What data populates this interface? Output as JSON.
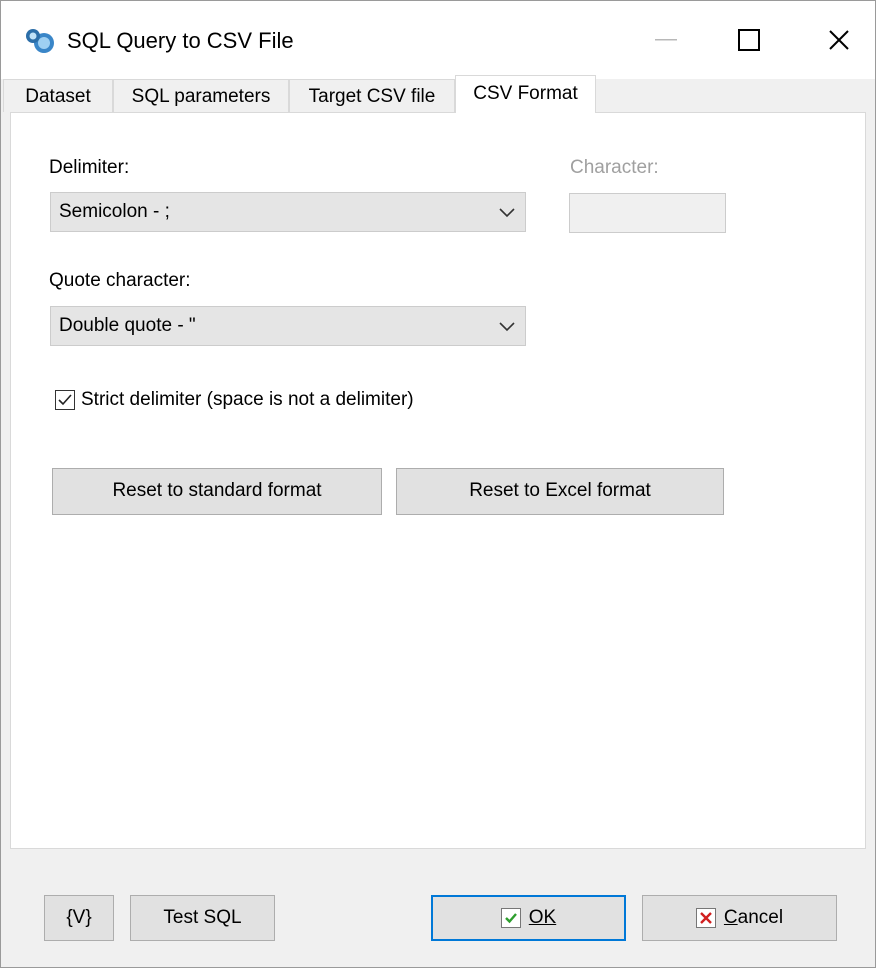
{
  "window": {
    "title": "SQL Query to CSV File",
    "minimize_icon": "minimize-icon",
    "maximize_icon": "maximize-icon",
    "close_icon": "close-icon"
  },
  "tabs": [
    {
      "label": "Dataset",
      "active": false
    },
    {
      "label": "SQL parameters",
      "active": false
    },
    {
      "label": "Target CSV file",
      "active": false
    },
    {
      "label": "CSV Format",
      "active": true
    }
  ],
  "csv_format": {
    "delimiter_label": "Delimiter:",
    "delimiter_value": "Semicolon - ;",
    "character_label": "Character:",
    "character_value": "",
    "quote_label": "Quote character:",
    "quote_value": "Double quote - \"",
    "strict_label": "Strict delimiter (space is not a delimiter)",
    "strict_checked": true,
    "reset_standard_label": "Reset to standard format",
    "reset_excel_label": "Reset to Excel format"
  },
  "footer": {
    "variables_label": "{V}",
    "test_sql_label": "Test SQL",
    "ok_label": "OK",
    "cancel_label": "Cancel"
  },
  "colors": {
    "accent": "#0078d7",
    "ok_check": "#2e9e2e",
    "cancel_x": "#d11f1f"
  }
}
